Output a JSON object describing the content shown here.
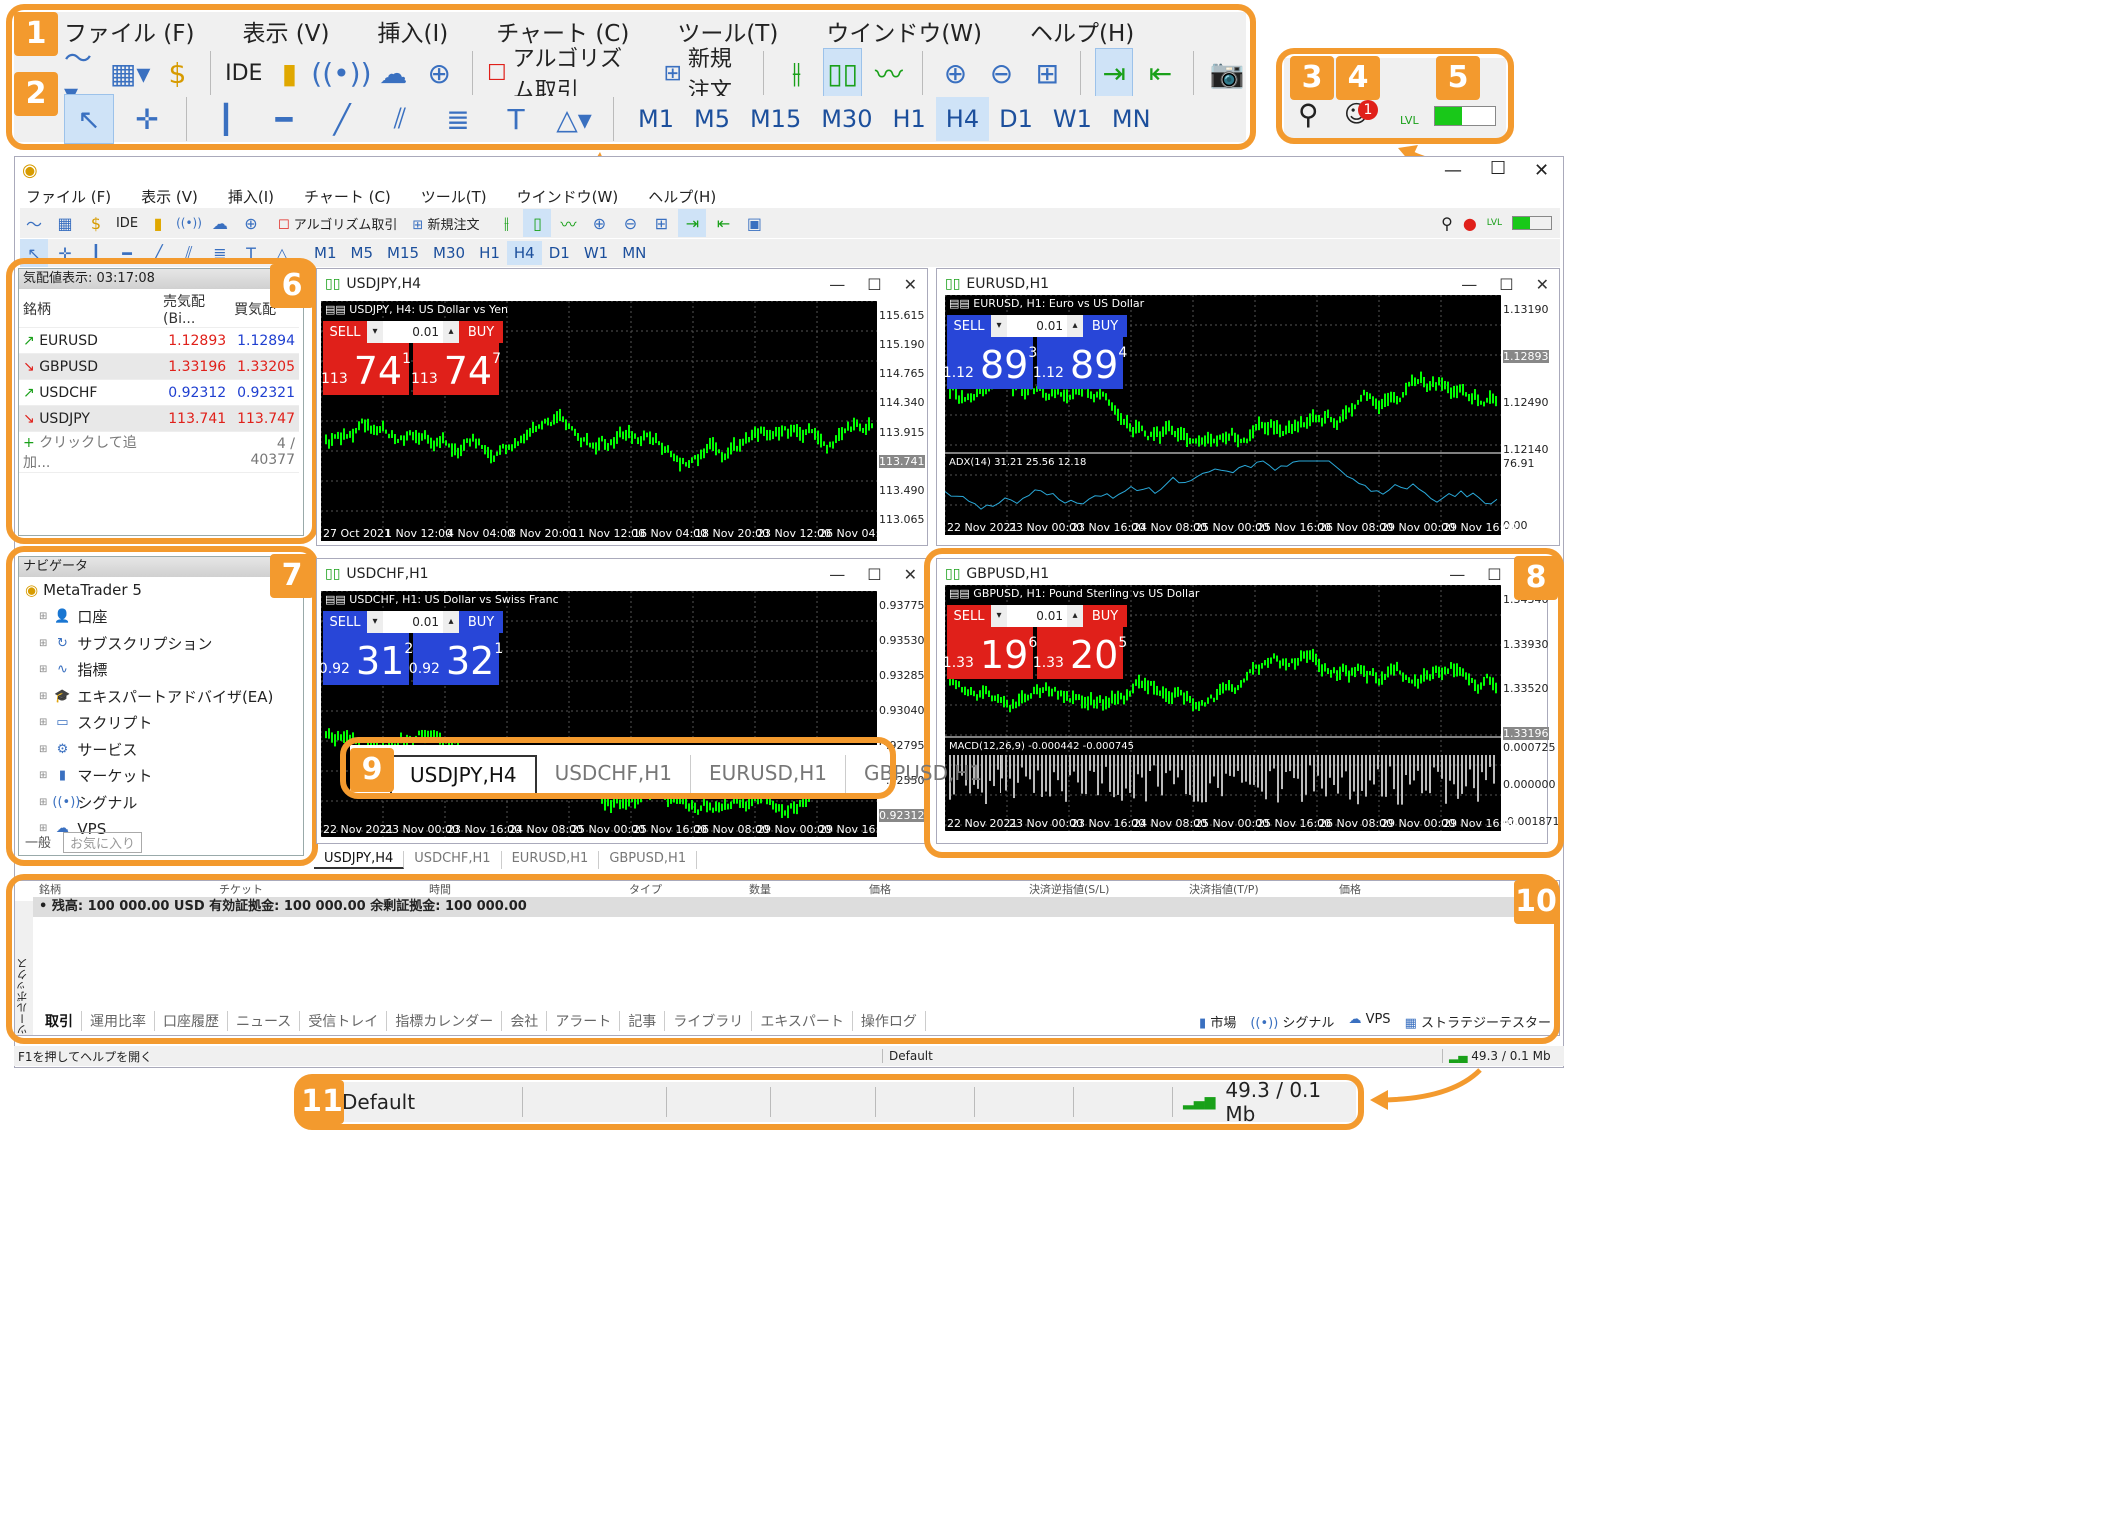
{
  "menu": [
    "ファイル (F)",
    "表示 (V)",
    "挿入(I)",
    "チャート (C)",
    "ツール(T)",
    "ウインドウ(W)",
    "ヘルプ(H)"
  ],
  "toolbar": {
    "ide": "IDE",
    "algo": "アルゴリズム取引",
    "neworder": "新規注文"
  },
  "timeframes": [
    "M1",
    "M5",
    "M15",
    "M30",
    "H1",
    "H4",
    "D1",
    "W1",
    "MN"
  ],
  "active_tf": "H4",
  "callouts": [
    "1",
    "2",
    "3",
    "4",
    "5",
    "6",
    "7",
    "8",
    "9",
    "10",
    "11"
  ],
  "notif_count": "1",
  "lvl": "LVL",
  "colors": {
    "accent": "#f39a2e",
    "bull": "#00ff00",
    "sell": "#e0201a",
    "buy_blue": "#2846d8"
  },
  "window_ctrl": {
    "min": "—",
    "max": "☐",
    "close": "✕"
  },
  "market_watch": {
    "title": "気配値表示: 03:17:08",
    "headers": [
      "銘柄",
      "売気配(Bi...",
      "買気配"
    ],
    "rows": [
      {
        "sym": "EURUSD",
        "bid": "1.12893",
        "ask": "1.12894",
        "dir": "up"
      },
      {
        "sym": "GBPUSD",
        "bid": "1.33196",
        "ask": "1.33205",
        "dir": "down"
      },
      {
        "sym": "USDCHF",
        "bid": "0.92312",
        "ask": "0.92321",
        "dir": "up"
      },
      {
        "sym": "USDJPY",
        "bid": "113.741",
        "ask": "113.747",
        "dir": "down"
      }
    ],
    "add": "クリックして追加...",
    "count": "4 / 40377"
  },
  "navigator": {
    "title": "ナビゲータ",
    "root": "MetaTrader 5",
    "items": [
      "口座",
      "サブスクリプション",
      "指標",
      "エキスパートアドバイザ(EA)",
      "スクリプト",
      "サービス",
      "マーケット",
      "シグナル",
      "VPS"
    ],
    "tabs": [
      "一般",
      "お気に入り"
    ]
  },
  "charts": [
    {
      "title": "USDJPY,H4",
      "desc": "USDJPY, H4: US Dollar vs Yen",
      "sell_big": "74",
      "sell_pre": "113",
      "sell_sup": "1",
      "buy_big": "74",
      "buy_pre": "113",
      "buy_sup": "7",
      "lot": "0.01",
      "yaxis": [
        "115.615",
        "115.190",
        "114.765",
        "114.340",
        "113.915",
        "113.741",
        "113.490",
        "113.065"
      ],
      "xaxis": [
        "27 Oct 2021",
        "1 Nov 12:00",
        "4 Nov 04:00",
        "8 Nov 20:00",
        "11 Nov 12:00",
        "16 Nov 04:00",
        "18 Nov 20:00",
        "23 Nov 12:00",
        "26 Nov 04:00"
      ]
    },
    {
      "title": "EURUSD,H1",
      "desc": "EURUSD, H1: Euro vs US Dollar",
      "sell_big": "89",
      "sell_pre": "1.12",
      "sell_sup": "3",
      "buy_big": "89",
      "buy_pre": "1.12",
      "buy_sup": "4",
      "lot": "0.01",
      "yaxis": [
        "1.13190",
        "1.12893",
        "1.12490",
        "1.12140"
      ],
      "ind": "ADX(14) 31.21 25.56 12.18",
      "ind_axis": [
        "76.91",
        "0.00"
      ],
      "xaxis": [
        "22 Nov 2021",
        "23 Nov 00:00",
        "23 Nov 16:00",
        "24 Nov 08:00",
        "25 Nov 00:00",
        "25 Nov 16:00",
        "26 Nov 08:00",
        "29 Nov 00:00",
        "29 Nov 16:00"
      ]
    },
    {
      "title": "USDCHF,H1",
      "desc": "USDCHF, H1: US Dollar vs Swiss Franc",
      "sell_big": "31",
      "sell_pre": "0.92",
      "sell_sup": "2",
      "buy_big": "32",
      "buy_pre": "0.92",
      "buy_sup": "1",
      "lot": "0.01",
      "yaxis": [
        "0.93775",
        "0.93530",
        "0.93285",
        "0.93040",
        "0.92795",
        "0.92550",
        "0.92312"
      ],
      "xaxis": [
        "22 Nov 2021",
        "23 Nov 00:00",
        "23 Nov 16:00",
        "24 Nov 08:00",
        "25 Nov 00:00",
        "25 Nov 16:00",
        "26 Nov 08:00",
        "29 Nov 00:00",
        "29 Nov 16:00"
      ]
    },
    {
      "title": "GBPUSD,H1",
      "desc": "GBPUSD, H1: Pound Sterling vs US Dollar",
      "sell_big": "19",
      "sell_pre": "1.33",
      "sell_sup": "6",
      "buy_big": "20",
      "buy_pre": "1.33",
      "buy_sup": "5",
      "lot": "0.01",
      "yaxis": [
        "1.34340",
        "1.33930",
        "1.33520",
        "1.33196"
      ],
      "ind": "MACD(12,26,9) -0.000442 -0.000745",
      "ind_axis": [
        "0.000725",
        "0.000000",
        "-0.001871"
      ],
      "xaxis": [
        "22 Nov 2021",
        "23 Nov 00:00",
        "23 Nov 16:00",
        "24 Nov 08:00",
        "25 Nov 00:00",
        "25 Nov 16:00",
        "26 Nov 08:00",
        "29 Nov 00:00",
        "29 Nov 16:00"
      ]
    }
  ],
  "sell": "SELL",
  "buy": "BUY",
  "chart_tabs": [
    "USDJPY,H4",
    "USDCHF,H1",
    "EURUSD,H1",
    "GBPUSD,H1"
  ],
  "toolbox": {
    "side": "ツールボックス",
    "headers": [
      "銘柄",
      "チケット",
      "時間",
      "タイプ",
      "数量",
      "価格",
      "決済逆指値(S/L)",
      "決済指値(T/P)",
      "価格"
    ],
    "balance": "残高: 100 000.00 USD  有効証拠金: 100 000.00  余剰証拠金: 100 000.00",
    "tabs": [
      "取引",
      "運用比率",
      "口座履歴",
      "ニュース",
      "受信トレイ",
      "指標カレンダー",
      "会社",
      "アラート",
      "記事",
      "ライブラリ",
      "エキスパート",
      "操作ログ"
    ],
    "right": [
      "市場",
      "シグナル",
      "VPS",
      "ストラテジーテスター"
    ]
  },
  "status": {
    "help": "F1を押してヘルプを開く",
    "profile": "Default",
    "traffic": "49.3 / 0.1 Mb"
  }
}
